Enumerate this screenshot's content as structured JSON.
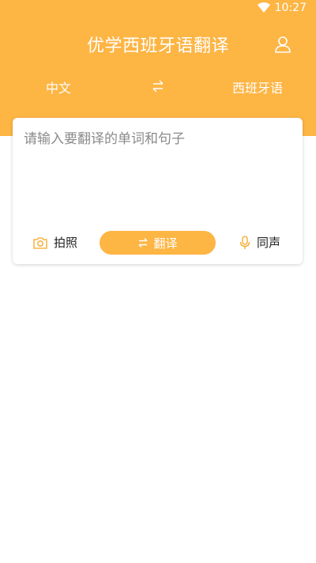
{
  "status_bar": {
    "time": "10:27",
    "wifi_icon": "wifi-icon"
  },
  "header": {
    "title": "优学西班牙语翻译",
    "profile_icon": "user-icon",
    "background_color": "#fdb544"
  },
  "language_bar": {
    "source_language": "中文",
    "swap_icon": "swap-arrows-icon",
    "target_language": "西班牙语"
  },
  "input_card": {
    "placeholder": "请输入要翻译的单词和句子",
    "value": "",
    "photo": {
      "icon": "camera-icon",
      "label": "拍照"
    },
    "translate": {
      "icon": "swap-arrows-icon",
      "label": "翻译"
    },
    "voice": {
      "icon": "microphone-icon",
      "label": "同声"
    }
  },
  "colors": {
    "accent": "#fdb544",
    "icon_accent": "#f5a623"
  }
}
